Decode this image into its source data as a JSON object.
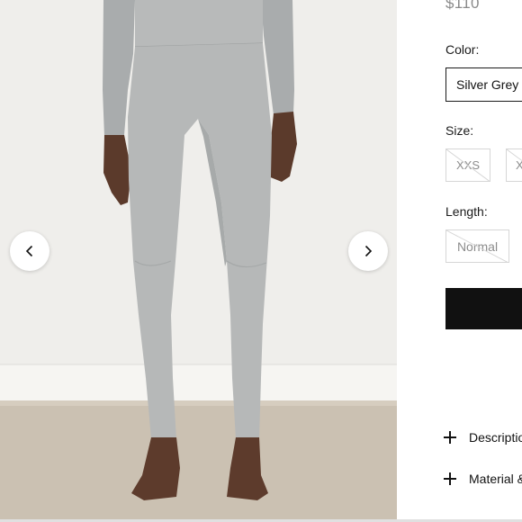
{
  "product": {
    "price": "$110"
  },
  "gallery": {
    "image_alt": "Model wearing silver grey high-rise leggings with matching long-sleeve top",
    "prev_icon": "chevron-left-icon",
    "next_icon": "chevron-right-icon"
  },
  "options": {
    "color_label": "Color:",
    "color_value": "Silver Grey",
    "size_label": "Size:",
    "sizes": [
      "XXS",
      "X"
    ],
    "length_label": "Length:",
    "length_value": "Normal"
  },
  "accordion": {
    "description_label": "Descriptio",
    "material_label": "Material &",
    "icon": "plus-icon"
  },
  "colors": {
    "legging": "#b5b7b7",
    "button": "#111111",
    "chip_border": "#d6d6d6"
  }
}
